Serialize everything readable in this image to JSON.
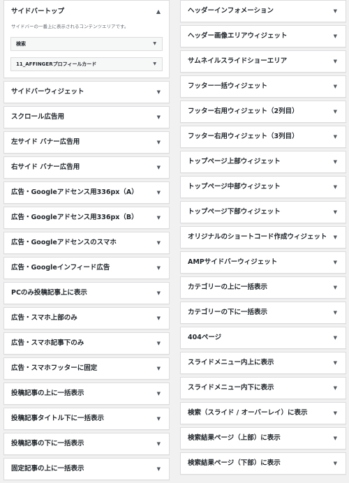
{
  "left_column": {
    "open_area": {
      "title": "サイドバートップ",
      "arrow": "▲",
      "description": "サイドバーの一番上に表示されるコンテンツエリアです。",
      "widgets": [
        {
          "title": "検索",
          "arrow": "▼"
        },
        {
          "title": "11_AFFINGERプロフィールカード",
          "arrow": "▼"
        }
      ]
    },
    "areas": [
      "サイドバーウィジェット",
      "スクロール広告用",
      "左サイド バナー広告用",
      "右サイド バナー広告用",
      "広告・Googleアドセンス用336px（A）",
      "広告・Googleアドセンス用336px（B）",
      "広告・Googleアドセンスのスマホ",
      "広告・Googleインフィード広告",
      "PCのみ投稿記事上に表示",
      "広告・スマホ上部のみ",
      "広告・スマホ記事下のみ",
      "広告・スマホフッターに固定",
      "投稿記事の上に一括表示",
      "投稿記事タイトル下に一括表示",
      "投稿記事の下に一括表示",
      "固定記事の上に一括表示"
    ]
  },
  "right_column": {
    "areas": [
      "ヘッダーインフォメーション",
      "ヘッダー画像エリアウィジェット",
      "サムネイルスライドショーエリア",
      "フッター一括ウィジェット",
      "フッター右用ウィジェット（2列目）",
      "フッター右用ウィジェット（3列目）",
      "トップページ上部ウィジェット",
      "トップページ中部ウィジェット",
      "トップページ下部ウィジェット",
      "オリジナルのショートコード作成ウィジェット",
      "AMPサイドバーウィジェット",
      "カテゴリーの上に一括表示",
      "カテゴリーの下に一括表示",
      "404ページ",
      "スライドメニュー内上に表示",
      "スライドメニュー内下に表示",
      "検索（スライド / オーバーレイ）に表示",
      "検索結果ページ（上部）に表示",
      "検索結果ページ（下部）に表示"
    ]
  },
  "collapsed_arrow": "▼"
}
